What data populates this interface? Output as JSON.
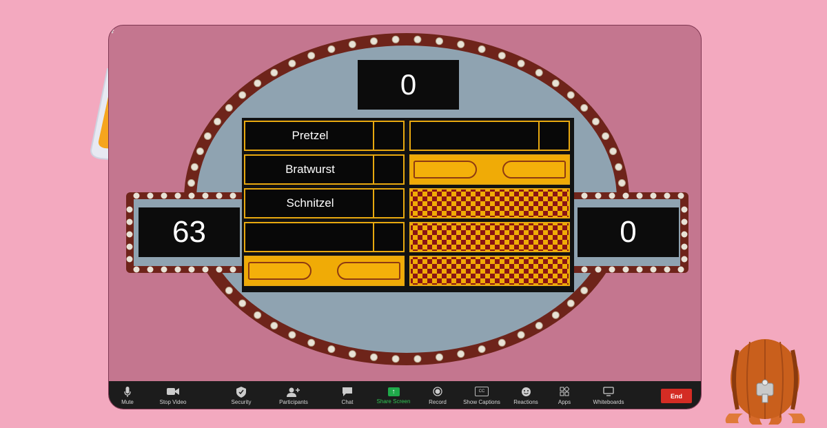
{
  "game": {
    "center_score": "0",
    "left_score": "63",
    "right_score": "0",
    "answers_left": [
      "Pretzel",
      "Bratwurst",
      "Schnitzel",
      "",
      ""
    ],
    "slot_states_left": [
      "revealed",
      "revealed",
      "revealed",
      "blank",
      "hidden"
    ],
    "slot_states_right": [
      "blank",
      "hidden",
      "struck",
      "struck",
      "struck"
    ]
  },
  "toolbar": {
    "mute": "Mute",
    "stop_video": "Stop Video",
    "security": "Security",
    "participants": "Participants",
    "chat": "Chat",
    "share_screen": "Share Screen",
    "record": "Record",
    "show_captions": "Show Captions",
    "reactions": "Reactions",
    "apps": "Apps",
    "whiteboards": "Whiteboards",
    "end": "End",
    "cc_glyph": "CC"
  },
  "icons": [
    "beer-mug-icon",
    "barrel-icon",
    "mic-icon",
    "video-icon",
    "shield-icon",
    "participants-icon",
    "chat-icon",
    "share-icon",
    "record-icon",
    "captions-icon",
    "reactions-icon",
    "apps-icon",
    "whiteboard-icon"
  ],
  "colors": {
    "background": "#f3a9bf",
    "board_frame": "#7a2b1d",
    "board_field": "#8da4b3",
    "slot_gold": "#f0ab06",
    "checker": "#8a1414",
    "share_green": "#1fa94a",
    "end_red": "#d42c24"
  }
}
